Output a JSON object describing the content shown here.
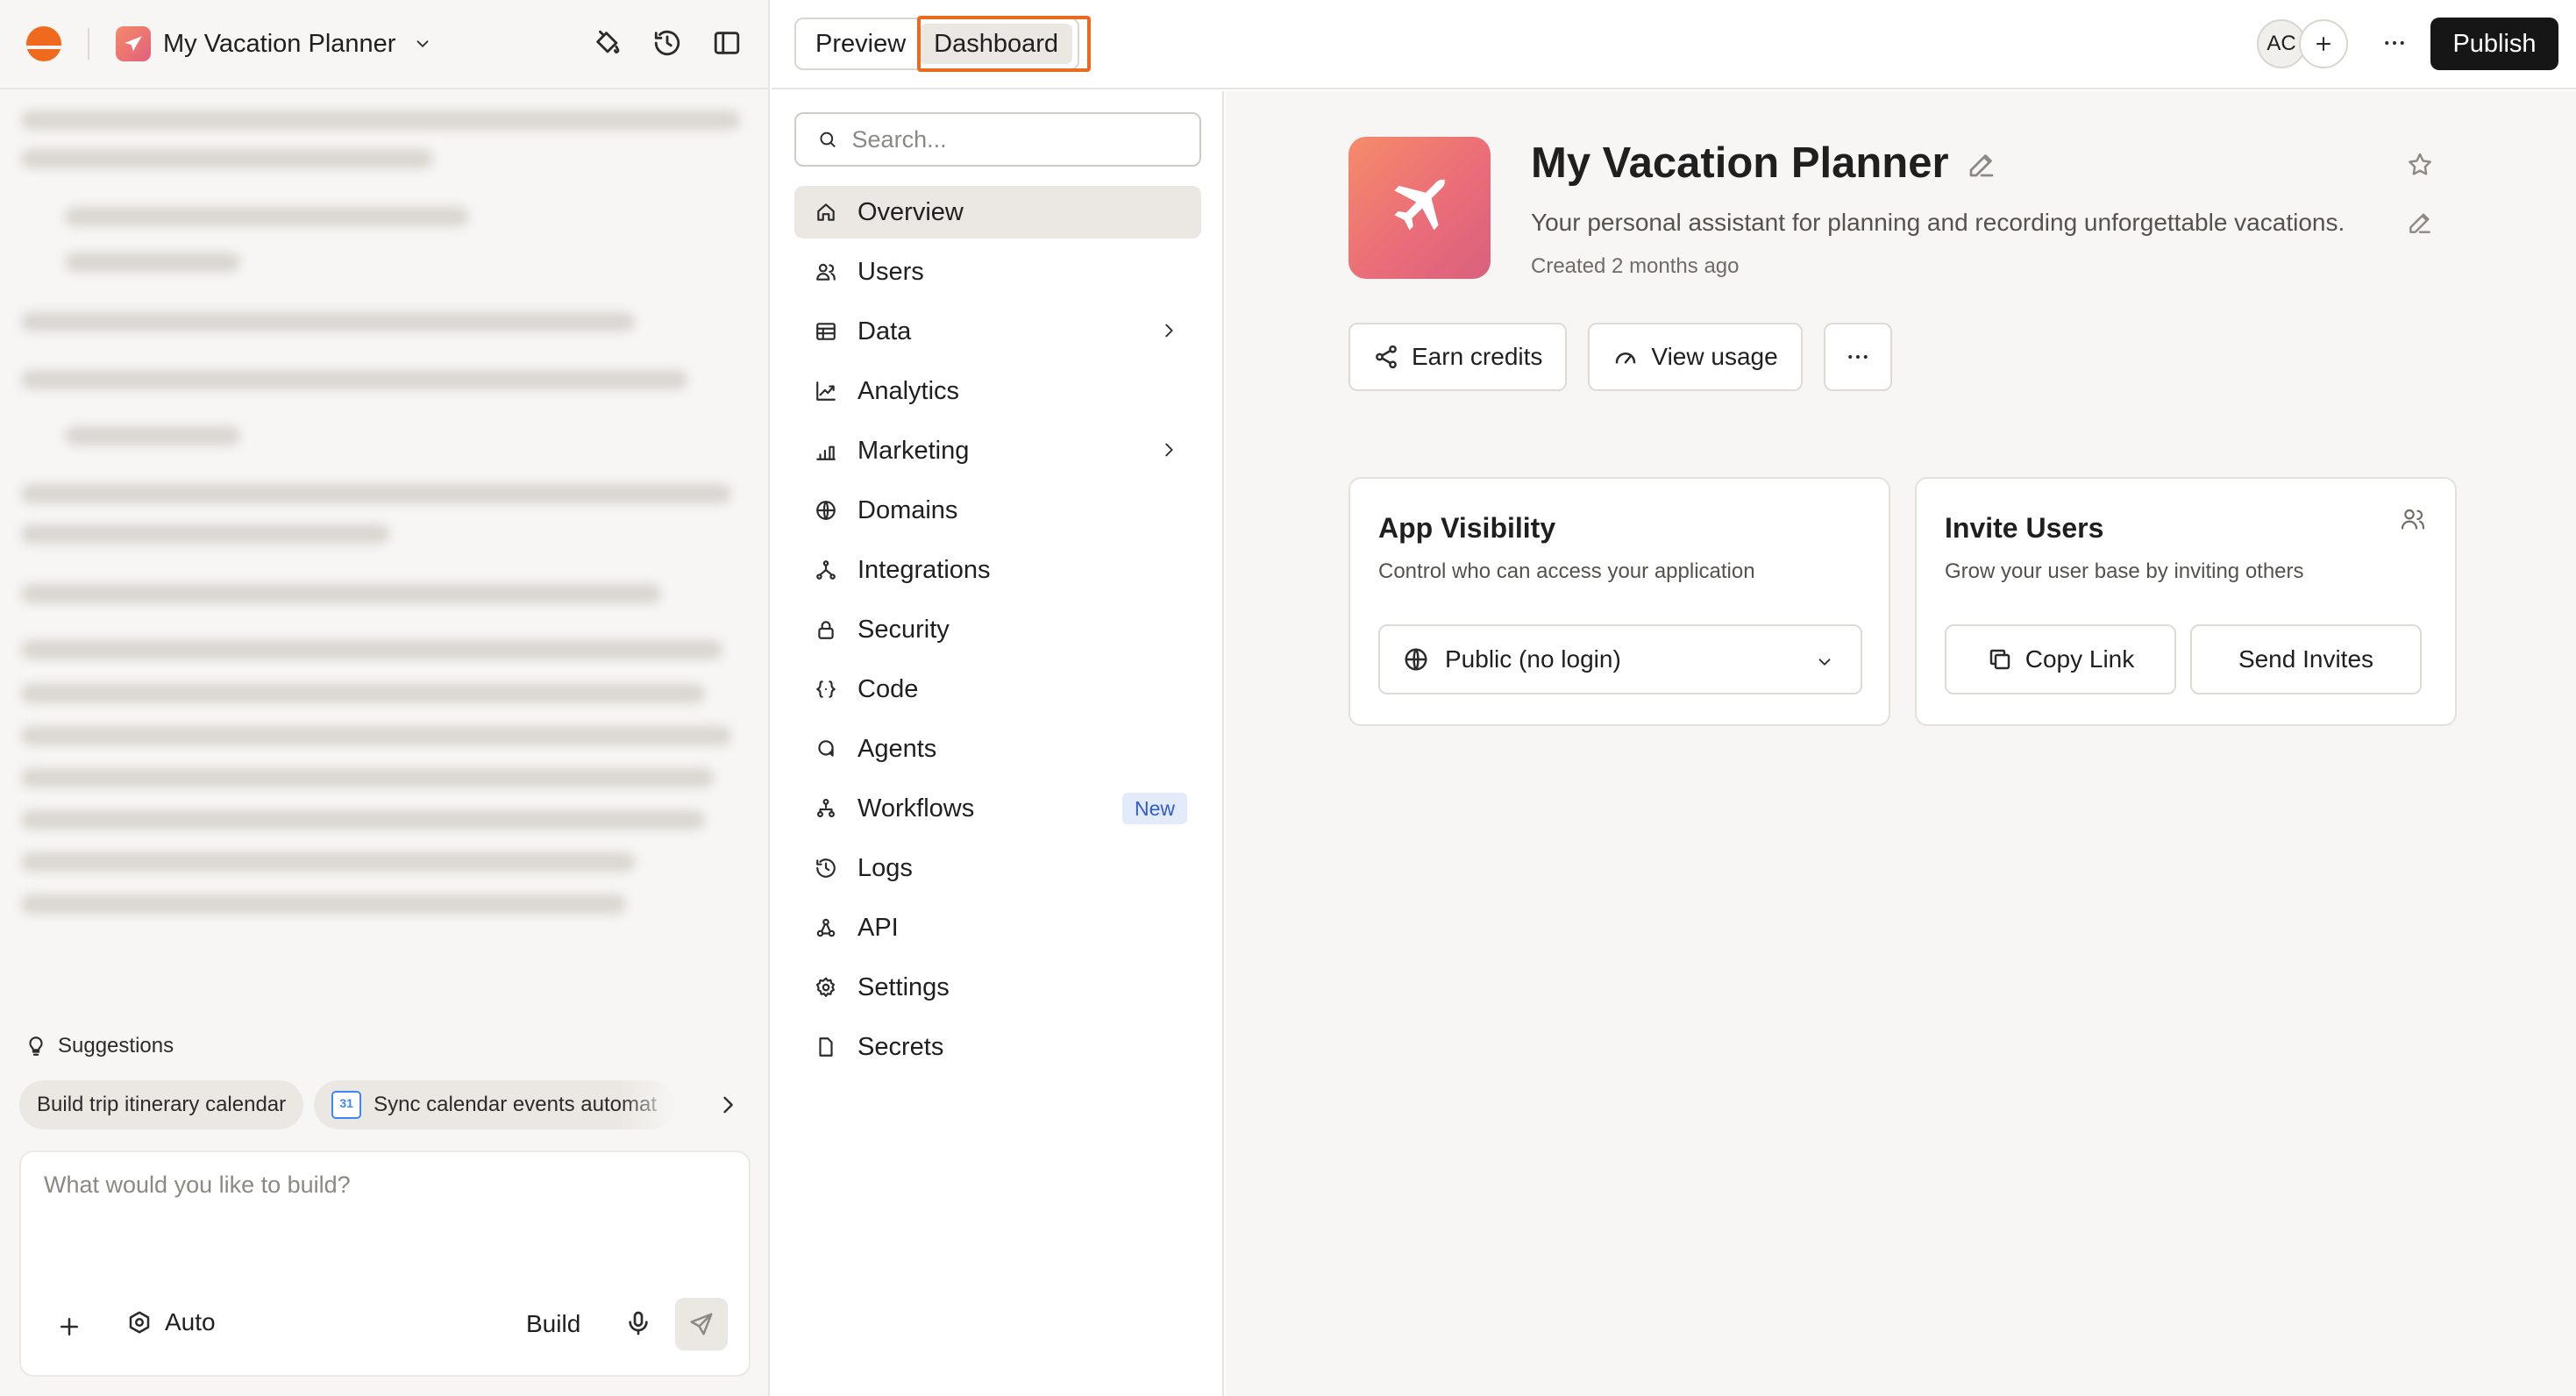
{
  "colors": {
    "brand": "#f06a1d",
    "highlight": "#ea6b1f",
    "publish_bg": "#161616",
    "new_badge": "#2f5ec8"
  },
  "left": {
    "app_name": "My Vacation Planner",
    "suggestions_label": "Suggestions",
    "suggestions": [
      "Build trip itinerary calendar",
      "Sync calendar events automat"
    ],
    "composer": {
      "placeholder": "What would you like to build?",
      "mode": "Auto",
      "build_label": "Build"
    }
  },
  "topbar": {
    "tabs": [
      "Preview",
      "Dashboard"
    ],
    "active_tab": "Dashboard",
    "avatar_initials": "AC",
    "publish_label": "Publish"
  },
  "nav": {
    "search_placeholder": "Search...",
    "items": [
      {
        "label": "Overview",
        "icon": "home-icon",
        "active": true
      },
      {
        "label": "Users",
        "icon": "users-icon"
      },
      {
        "label": "Data",
        "icon": "table-icon",
        "has_submenu": true
      },
      {
        "label": "Analytics",
        "icon": "chart-line-icon"
      },
      {
        "label": "Marketing",
        "icon": "bar-chart-icon",
        "has_submenu": true
      },
      {
        "label": "Domains",
        "icon": "globe-icon"
      },
      {
        "label": "Integrations",
        "icon": "integrations-icon"
      },
      {
        "label": "Security",
        "icon": "lock-icon"
      },
      {
        "label": "Code",
        "icon": "code-icon"
      },
      {
        "label": "Agents",
        "icon": "agent-icon"
      },
      {
        "label": "Workflows",
        "icon": "workflow-icon",
        "badge": "New"
      },
      {
        "label": "Logs",
        "icon": "history-icon"
      },
      {
        "label": "API",
        "icon": "api-icon"
      },
      {
        "label": "Settings",
        "icon": "gear-icon"
      },
      {
        "label": "Secrets",
        "icon": "file-icon"
      }
    ]
  },
  "main": {
    "title": "My Vacation Planner",
    "description": "Your personal assistant for planning and recording unforgettable vacations.",
    "created": "Created 2 months ago",
    "actions": {
      "earn_credits": "Earn credits",
      "view_usage": "View usage"
    },
    "visibility_card": {
      "title": "App Visibility",
      "subtitle": "Control who can access your application",
      "selected": "Public (no login)"
    },
    "invite_card": {
      "title": "Invite Users",
      "subtitle": "Grow your user base by inviting others",
      "copy_link": "Copy Link",
      "send_invites": "Send Invites"
    }
  }
}
